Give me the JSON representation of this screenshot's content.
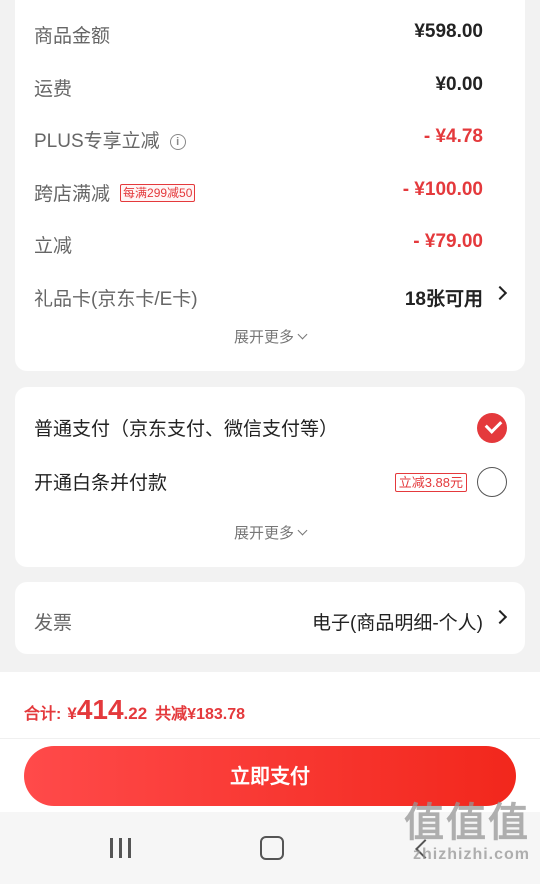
{
  "price_card": {
    "rows": [
      {
        "label": "商品金额",
        "value": "¥598.00"
      },
      {
        "label": "运费",
        "value": "¥0.00"
      },
      {
        "label": "PLUS专享立减",
        "value": "- ¥4.78"
      },
      {
        "label": "跨店满减",
        "tag": "每满299减50",
        "value": "- ¥100.00"
      },
      {
        "label": "立减",
        "value": "- ¥79.00"
      },
      {
        "label": "礼品卡(京东卡/E卡)",
        "value": "18张可用"
      }
    ],
    "info_icon": "info-icon",
    "expand": "展开更多"
  },
  "payment_card": {
    "options": [
      {
        "label": "普通支付（京东支付、微信支付等）",
        "selected": true
      },
      {
        "label": "开通白条并付款",
        "tag": "立减3.88元",
        "selected": false
      }
    ],
    "expand": "展开更多"
  },
  "invoice": {
    "label": "发票",
    "value": "电子(商品明细-个人)"
  },
  "summary": {
    "total_label": "合计:",
    "currency": "¥",
    "total_int": "414",
    "total_dec": ".22",
    "saved": "共减¥183.78"
  },
  "pay_button": "立即支付",
  "watermark": {
    "big": "值值值",
    "small": "zhizhizhi.com"
  },
  "colors": {
    "accent": "#e4393c",
    "background": "#f2f2f2"
  }
}
